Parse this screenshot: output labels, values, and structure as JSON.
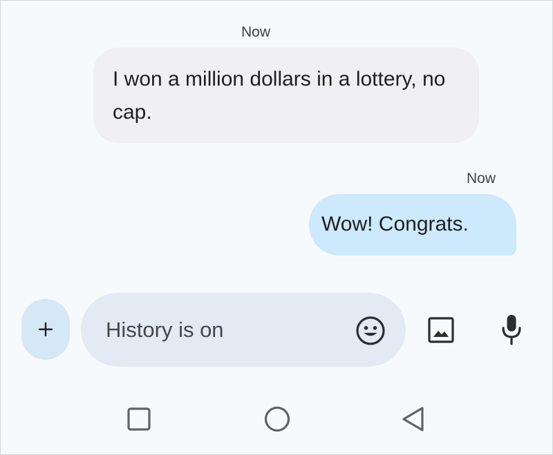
{
  "conversation": {
    "messages": [
      {
        "direction": "incoming",
        "timestamp": "Now",
        "text": "I won a million dollars in a lottery, no cap."
      },
      {
        "direction": "outgoing",
        "timestamp": "Now",
        "text": "Wow! Congrats."
      }
    ]
  },
  "compose": {
    "placeholder": "History is on",
    "value": "",
    "add_icon": "plus-icon",
    "emoji_icon": "emoji-icon",
    "gallery_icon": "gallery-icon",
    "mic_icon": "microphone-icon"
  },
  "nav": {
    "recents_icon": "square-icon",
    "home_icon": "circle-icon",
    "back_icon": "triangle-back-icon"
  },
  "colors": {
    "background": "#f7fafd",
    "incoming_bubble": "#f0f0f2",
    "outgoing_bubble": "#cde9fc",
    "compose_field": "#e4eaf3",
    "add_button": "#d6e7f5",
    "icon": "#2b2f33",
    "nav_icon": "#5f6368"
  }
}
